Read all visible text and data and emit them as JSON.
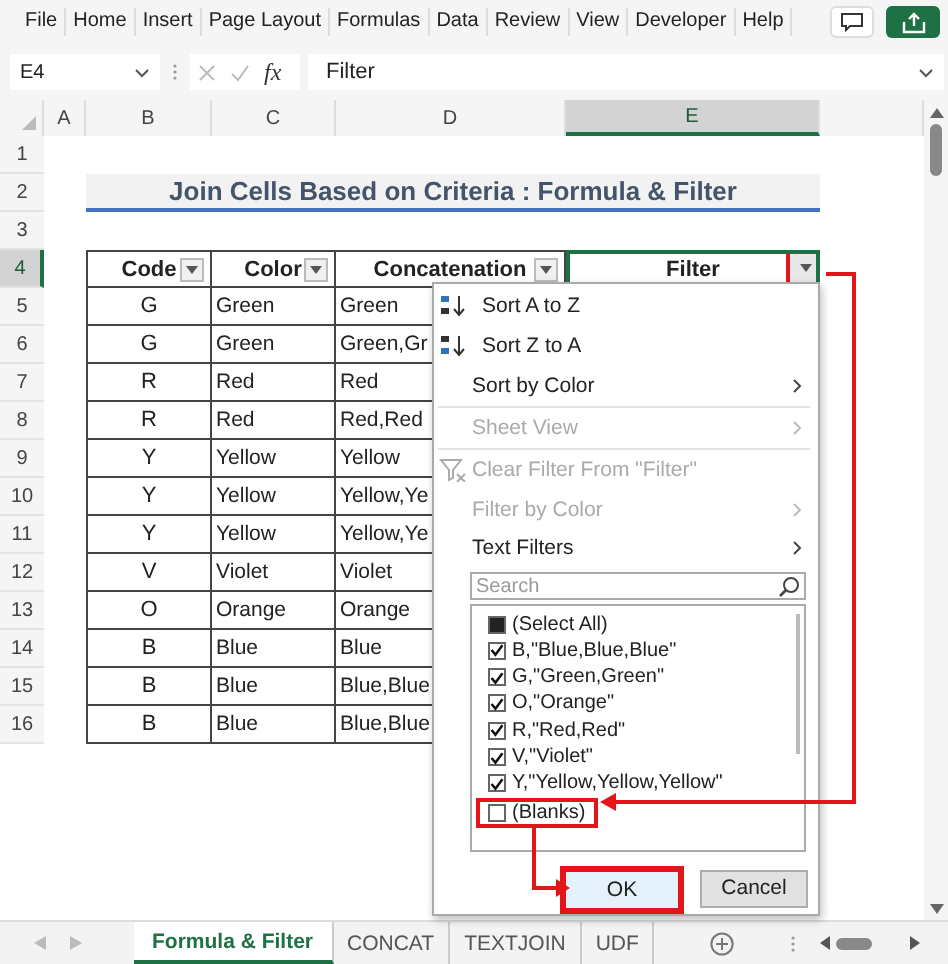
{
  "ribbon_tabs": [
    "File",
    "Home",
    "Insert",
    "Page Layout",
    "Formulas",
    "Data",
    "Review",
    "View",
    "Developer",
    "Help"
  ],
  "formula_bar": {
    "name_box": "E4",
    "fx": "fx",
    "value": "Filter"
  },
  "columns": [
    {
      "label": "A",
      "selected": false
    },
    {
      "label": "B",
      "selected": false
    },
    {
      "label": "C",
      "selected": false
    },
    {
      "label": "D",
      "selected": false
    },
    {
      "label": "E",
      "selected": true
    }
  ],
  "rows": [
    {
      "number": "1",
      "kind": "blank",
      "selected": false
    },
    {
      "number": "2",
      "kind": "title",
      "selected": false,
      "title": "Join Cells Based on Criteria : Formula & Filter"
    },
    {
      "number": "3",
      "kind": "blank",
      "selected": false
    },
    {
      "number": "4",
      "kind": "header",
      "selected": true,
      "headers": [
        {
          "label": "Code",
          "selected": false,
          "highlighted": false
        },
        {
          "label": "Color",
          "selected": false,
          "highlighted": false
        },
        {
          "label": "Concatenation",
          "selected": false,
          "highlighted": false
        },
        {
          "label": "Filter",
          "selected": true,
          "highlighted": true
        }
      ]
    },
    {
      "number": "5",
      "kind": "data",
      "selected": false,
      "cells": [
        "G",
        "Green",
        "Green"
      ]
    },
    {
      "number": "6",
      "kind": "data",
      "selected": false,
      "cells": [
        "G",
        "Green",
        "Green,Gr"
      ]
    },
    {
      "number": "7",
      "kind": "data",
      "selected": false,
      "cells": [
        "R",
        "Red",
        "Red"
      ]
    },
    {
      "number": "8",
      "kind": "data",
      "selected": false,
      "cells": [
        "R",
        "Red",
        "Red,Red"
      ]
    },
    {
      "number": "9",
      "kind": "data",
      "selected": false,
      "cells": [
        "Y",
        "Yellow",
        "Yellow"
      ]
    },
    {
      "number": "10",
      "kind": "data",
      "selected": false,
      "cells": [
        "Y",
        "Yellow",
        "Yellow,Ye"
      ]
    },
    {
      "number": "11",
      "kind": "data",
      "selected": false,
      "cells": [
        "Y",
        "Yellow",
        "Yellow,Ye"
      ]
    },
    {
      "number": "12",
      "kind": "data",
      "selected": false,
      "cells": [
        "V",
        "Violet",
        "Violet"
      ]
    },
    {
      "number": "13",
      "kind": "data",
      "selected": false,
      "cells": [
        "O",
        "Orange",
        "Orange"
      ]
    },
    {
      "number": "14",
      "kind": "data",
      "selected": false,
      "cells": [
        "B",
        "Blue",
        "Blue"
      ]
    },
    {
      "number": "15",
      "kind": "data",
      "selected": false,
      "cells": [
        "B",
        "Blue",
        "Blue,Blue"
      ]
    },
    {
      "number": "16",
      "kind": "data",
      "selected": false,
      "cells": [
        "B",
        "Blue",
        "Blue,Blue"
      ]
    }
  ],
  "filter_menu": {
    "items": [
      {
        "label": "Sort A to Z",
        "kind": "sort-asc",
        "disabled": false,
        "submenu": false,
        "divider": false
      },
      {
        "label": "Sort Z to A",
        "kind": "sort-desc",
        "disabled": false,
        "submenu": false,
        "divider": false
      },
      {
        "label": "Sort by Color",
        "kind": "plain",
        "disabled": false,
        "submenu": true,
        "divider": true
      },
      {
        "label": "Sheet View",
        "kind": "plain",
        "disabled": true,
        "submenu": true,
        "divider": true
      },
      {
        "label": "Clear Filter From \"Filter\"",
        "kind": "clear-filter",
        "disabled": true,
        "submenu": false,
        "divider": false
      },
      {
        "label": "Filter by Color",
        "kind": "plain",
        "disabled": true,
        "submenu": true,
        "divider": false
      },
      {
        "label": "Text Filters",
        "kind": "plain",
        "disabled": false,
        "submenu": true,
        "divider": false
      }
    ],
    "search": {
      "placeholder": "Search"
    },
    "options": [
      {
        "label": "(Select All)",
        "checked": true,
        "partial": true,
        "highlighted": false
      },
      {
        "label": "B,\"Blue,Blue,Blue\"",
        "checked": true,
        "partial": false,
        "highlighted": false
      },
      {
        "label": "G,\"Green,Green\"",
        "checked": true,
        "partial": false,
        "highlighted": false
      },
      {
        "label": "O,\"Orange\"",
        "checked": true,
        "partial": false,
        "highlighted": false
      },
      {
        "label": "R,\"Red,Red\"",
        "checked": true,
        "partial": false,
        "highlighted": false
      },
      {
        "label": "V,\"Violet\"",
        "checked": true,
        "partial": false,
        "highlighted": false
      },
      {
        "label": "Y,\"Yellow,Yellow,Yellow\"",
        "checked": true,
        "partial": false,
        "highlighted": false
      },
      {
        "label": "(Blanks)",
        "checked": false,
        "partial": false,
        "highlighted": true
      }
    ],
    "buttons": [
      {
        "label": "OK",
        "default": true,
        "highlighted": true
      },
      {
        "label": "Cancel",
        "default": false,
        "highlighted": false
      }
    ]
  },
  "sheet_tabs": [
    {
      "label": "Formula & Filter",
      "selected": true
    },
    {
      "label": "CONCAT",
      "selected": false
    },
    {
      "label": "TEXTJOIN",
      "selected": false
    },
    {
      "label": "UDF",
      "selected": false
    }
  ]
}
